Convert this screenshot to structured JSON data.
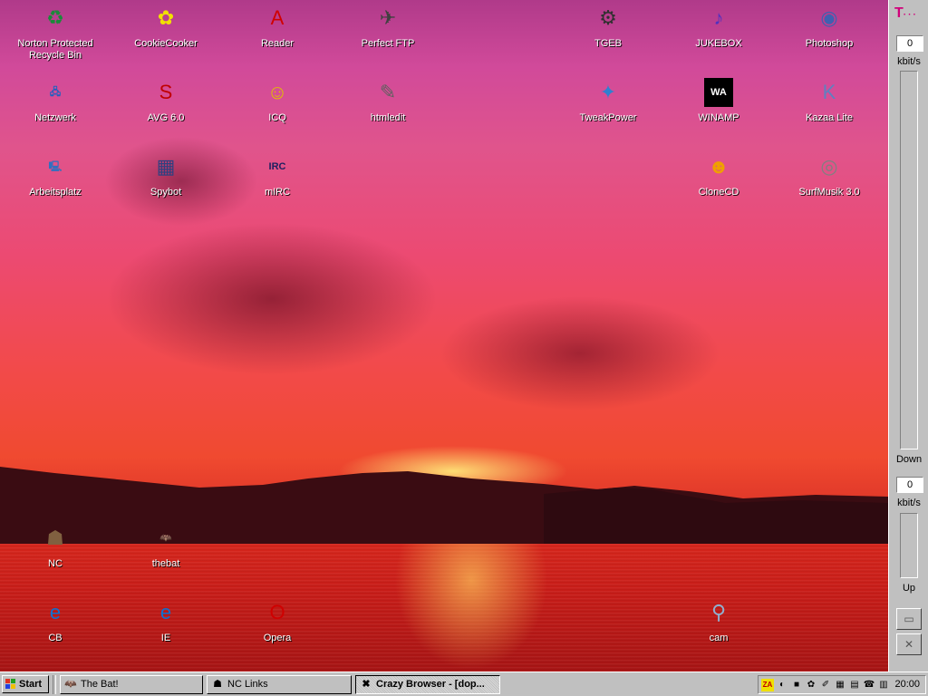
{
  "desktop": {
    "icons": [
      {
        "label": "Norton Protected Recycle Bin",
        "glyph": "♻",
        "color": "#1a8a3a",
        "shortcut": false
      },
      {
        "label": "CookieCooker",
        "glyph": "✿",
        "color": "#f0e000",
        "shortcut": false
      },
      {
        "label": "Reader",
        "glyph": "A",
        "color": "#d00000",
        "shortcut": true
      },
      {
        "label": "Perfect FTP",
        "glyph": "✈",
        "color": "#404040",
        "shortcut": true
      },
      {
        "label": "TGEB",
        "glyph": "⚙",
        "color": "#303030",
        "shortcut": true
      },
      {
        "label": "JUKEBOX",
        "glyph": "♪",
        "color": "#5030c0",
        "shortcut": true
      },
      {
        "label": "Photoshop",
        "glyph": "◉",
        "color": "#4060b0",
        "shortcut": true
      },
      {
        "label": "Netzwerk",
        "glyph": "🖧",
        "color": "#2060c0",
        "shortcut": false
      },
      {
        "label": "AVG 6.0",
        "glyph": "S",
        "color": "#c00000",
        "shortcut": true
      },
      {
        "label": "ICQ",
        "glyph": "☺",
        "color": "#e0c000",
        "shortcut": true
      },
      {
        "label": "htmledit",
        "glyph": "✎",
        "color": "#606060",
        "shortcut": true
      },
      {
        "label": "TweakPower",
        "glyph": "✦",
        "color": "#3080d0",
        "shortcut": true
      },
      {
        "label": "WINAMP",
        "glyph": "WA",
        "color": "#ffffff",
        "shortcut": true
      },
      {
        "label": "Kazaa Lite",
        "glyph": "K",
        "color": "#6080c0",
        "shortcut": true
      },
      {
        "label": "Arbeitsplatz",
        "glyph": "🖳",
        "color": "#3070c0",
        "shortcut": false
      },
      {
        "label": "Spybot",
        "glyph": "▦",
        "color": "#304080",
        "shortcut": true
      },
      {
        "label": "mIRC",
        "glyph": "IRC",
        "color": "#202060",
        "shortcut": true
      },
      {
        "label": "CloneCD",
        "glyph": "☻",
        "color": "#f0a000",
        "shortcut": true
      },
      {
        "label": "SurfMusik 3.0",
        "glyph": "◎",
        "color": "#808080",
        "shortcut": true
      },
      {
        "label": "NC",
        "glyph": "☗",
        "color": "#806040",
        "shortcut": true
      },
      {
        "label": "thebat",
        "glyph": "🦇",
        "color": "#e0c000",
        "shortcut": false
      },
      {
        "label": "CB",
        "glyph": "e",
        "color": "#1070d0",
        "shortcut": true
      },
      {
        "label": "IE",
        "glyph": "e",
        "color": "#1070d0",
        "shortcut": false
      },
      {
        "label": "Opera",
        "glyph": "O",
        "color": "#d00000",
        "shortcut": true
      },
      {
        "label": "cam",
        "glyph": "⚲",
        "color": "#90b0d0",
        "shortcut": true
      }
    ]
  },
  "meter": {
    "logo": "T",
    "logo_dots": "···",
    "down_value": "0",
    "down_unit": "kbit/s",
    "down_label": "Down",
    "up_value": "0",
    "up_unit": "kbit/s",
    "up_label": "Up",
    "btn_window": "▭",
    "btn_close": "✕"
  },
  "taskbar": {
    "start_label": "Start",
    "tasks": [
      {
        "label": "The Bat!",
        "icon": "🦇",
        "active": false
      },
      {
        "label": "NC Links",
        "icon": "☗",
        "active": false
      },
      {
        "label": "Crazy Browser - [dop...",
        "icon": "✖",
        "active": true
      }
    ],
    "tray_icons": [
      "ZA",
      "◐",
      "■",
      "✿",
      "✐",
      "▦",
      "▤",
      "☎",
      "▥"
    ],
    "clock": "20:00"
  },
  "colors": {
    "accent": "#d0007a",
    "desktop_text": "#ffffff"
  }
}
